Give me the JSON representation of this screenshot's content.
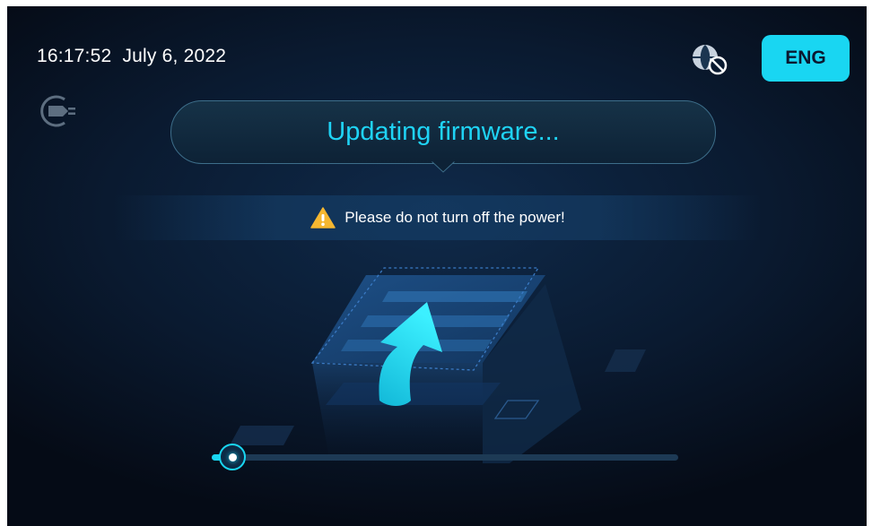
{
  "status_bar": {
    "time": "16:17:52",
    "date": "July 6, 2022",
    "network_icon": "globe-disconnected-icon",
    "language_label": "ENG"
  },
  "connection_icon": "charger-plug-icon",
  "update": {
    "title": "Updating firmware...",
    "warning_icon": "warning-triangle-icon",
    "warning_text": "Please do not turn off the power!",
    "progress_fraction": 0.045
  },
  "colors": {
    "accent": "#19d6f2",
    "background": "#0a1a30",
    "warning": "#f5b731"
  }
}
